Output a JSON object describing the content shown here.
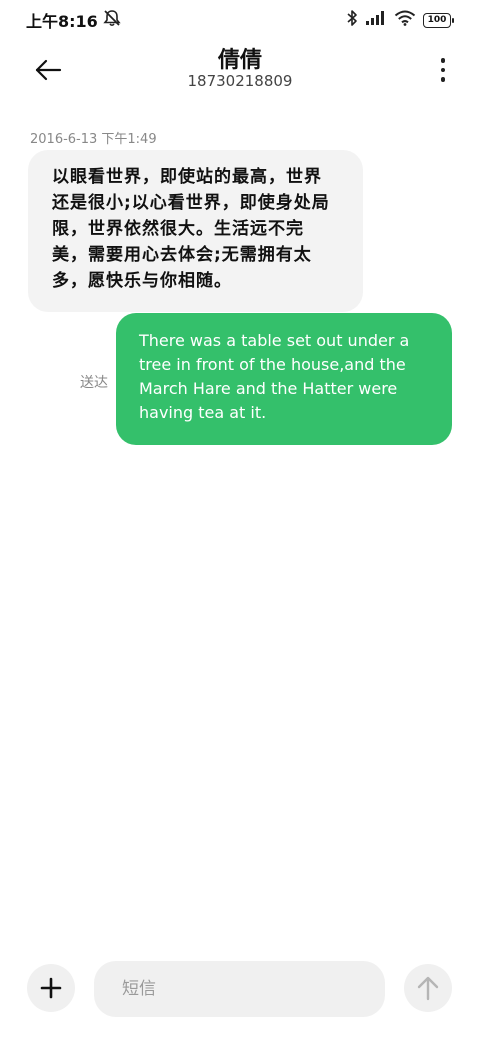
{
  "status_bar": {
    "time": "上午8:16",
    "battery": "100",
    "icons": [
      "mute-icon",
      "bluetooth-icon",
      "signal-icon",
      "wifi-icon",
      "battery-icon"
    ]
  },
  "header": {
    "title": "倩倩",
    "subtitle": "18730218809",
    "back_icon": "back-arrow-icon",
    "more_icon": "more-vertical-icon"
  },
  "conversation": {
    "timestamp": "2016-6-13 下午1:49",
    "incoming": {
      "text": "以眼看世界，即使站的最高，世界还是很小;以心看世界，即使身处局限，世界依然很大。生活远不完美，需要用心去体会;无需拥有太多，愿快乐与你相随。"
    },
    "outgoing": {
      "text": "There was a table set out under a tree in front of the house,and the March Hare and the Hatter were having tea at it.",
      "status": "送达"
    }
  },
  "compose": {
    "placeholder": "短信",
    "add_icon": "plus-icon",
    "send_icon": "send-arrow-up-icon"
  },
  "colors": {
    "outgoing_bubble": "#34c06b",
    "incoming_bubble": "#f3f3f3",
    "background": "#ffffff"
  }
}
